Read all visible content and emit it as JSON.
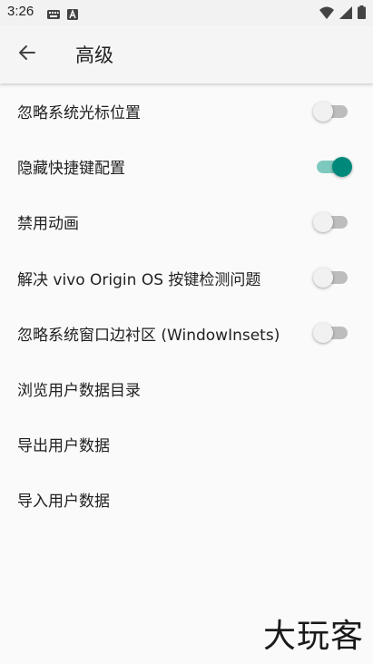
{
  "status_bar": {
    "time": "3:26",
    "left_icons": [
      "keyboard-icon",
      "a-letter-icon"
    ],
    "right_icons": [
      "wifi-icon",
      "signal-icon",
      "battery-icon"
    ]
  },
  "app_bar": {
    "back_icon": "arrow-back-icon",
    "title": "高级"
  },
  "settings": [
    {
      "label": "忽略系统光标位置",
      "has_switch": true,
      "switch_on": false
    },
    {
      "label": "隐藏快捷键配置",
      "has_switch": true,
      "switch_on": true
    },
    {
      "label": "禁用动画",
      "has_switch": true,
      "switch_on": false
    },
    {
      "label": "解决 vivo Origin OS 按键检测问题",
      "has_switch": true,
      "switch_on": false
    },
    {
      "label": "忽略系统窗口边衬区 (WindowInsets)",
      "has_switch": true,
      "switch_on": false
    },
    {
      "label": "浏览用户数据目录",
      "has_switch": false
    },
    {
      "label": "导出用户数据",
      "has_switch": false
    },
    {
      "label": "导入用户数据",
      "has_switch": false
    }
  ],
  "watermark": "大玩客",
  "colors": {
    "accent": "#00897b",
    "accent_track": "#7ec9bd",
    "switch_off_track": "#bdbdbd",
    "background": "#fafafa"
  }
}
